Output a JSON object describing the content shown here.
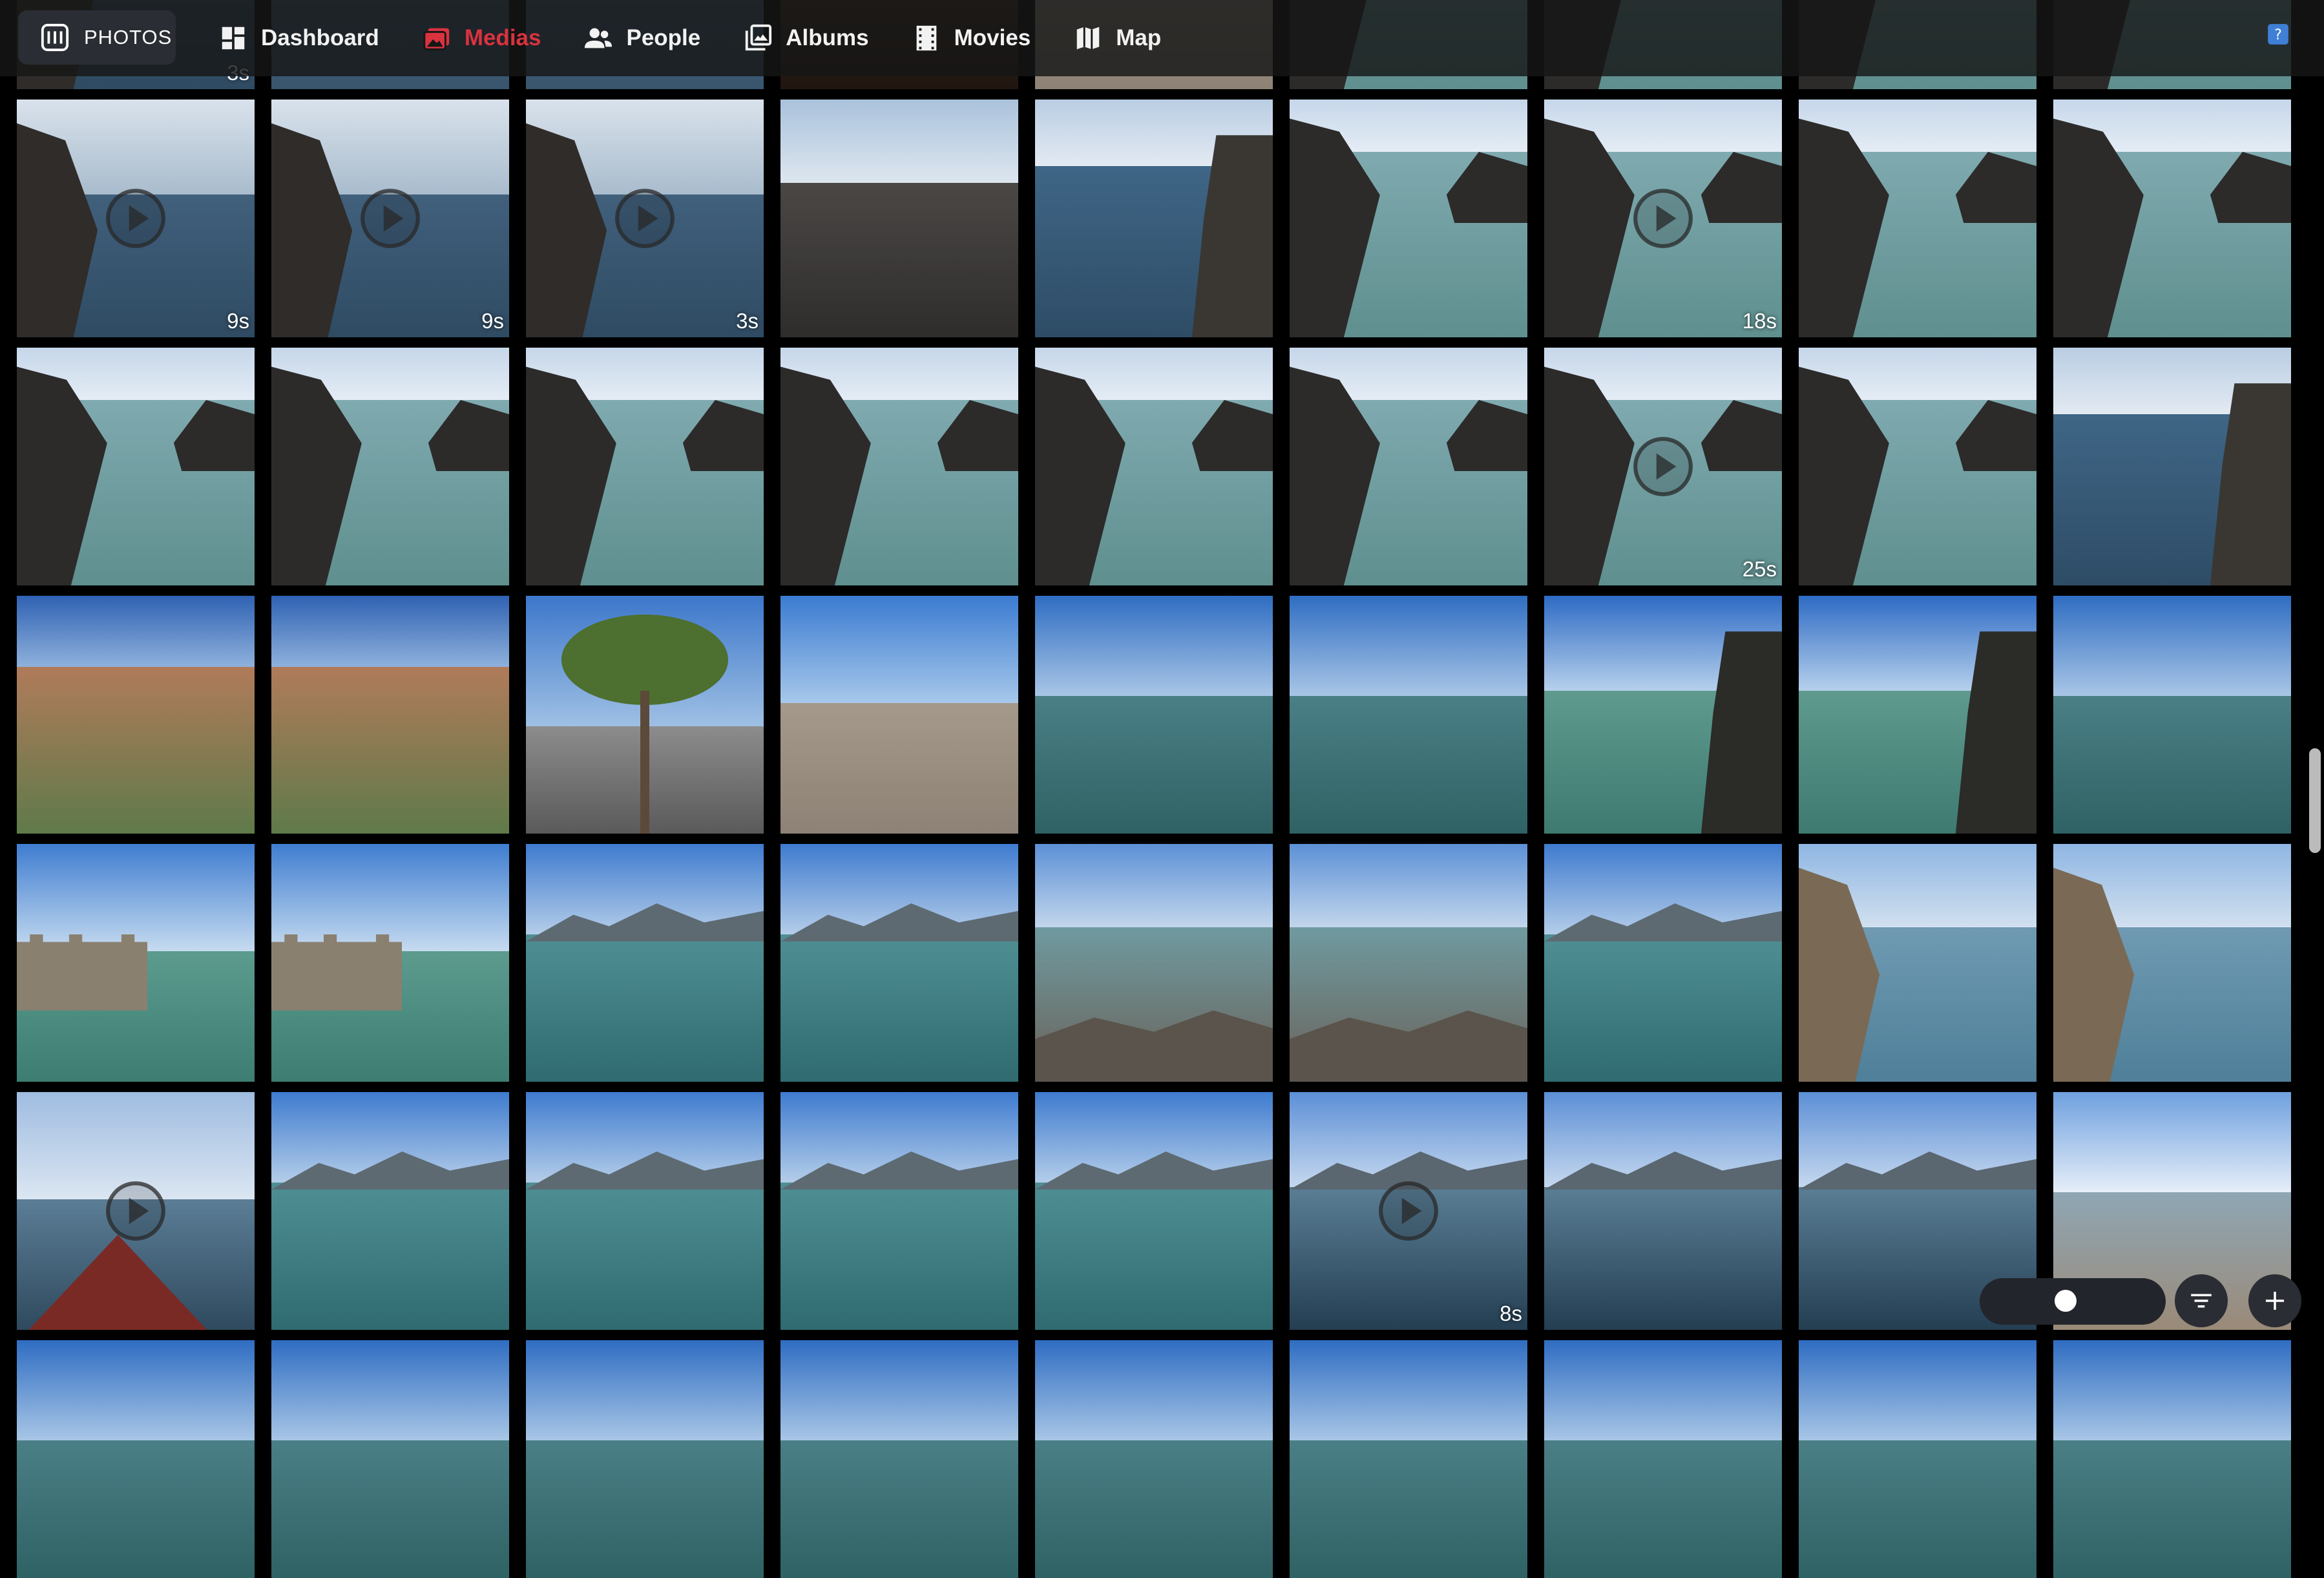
{
  "app": {
    "brand_label": "PHOTOS"
  },
  "nav": [
    {
      "label": "Dashboard",
      "icon": "dashboard-icon",
      "active": false
    },
    {
      "label": "Medias",
      "icon": "medias-icon",
      "active": true
    },
    {
      "label": "People",
      "icon": "people-icon",
      "active": false
    },
    {
      "label": "Albums",
      "icon": "albums-icon",
      "active": false
    },
    {
      "label": "Movies",
      "icon": "movies-icon",
      "active": false
    },
    {
      "label": "Map",
      "icon": "map-icon",
      "active": false
    }
  ],
  "accent_color": "#d8333f",
  "grid": {
    "rows": [
      {
        "tiles": [
          {
            "scene": "cliff",
            "video": false,
            "duration": "3s"
          },
          {
            "scene": "sea",
            "video": false,
            "duration": ""
          },
          {
            "scene": "sea",
            "video": false,
            "duration": ""
          },
          {
            "scene": "sunset",
            "video": false,
            "duration": ""
          },
          {
            "scene": "sand",
            "video": false,
            "duration": ""
          },
          {
            "scene": "pool",
            "video": false,
            "duration": ""
          },
          {
            "scene": "pool",
            "video": false,
            "duration": ""
          },
          {
            "scene": "pool",
            "video": false,
            "duration": ""
          },
          {
            "scene": "pool",
            "video": false,
            "duration": ""
          }
        ]
      },
      {
        "tiles": [
          {
            "scene": "cliff",
            "video": true,
            "duration": "9s"
          },
          {
            "scene": "cliff",
            "video": true,
            "duration": "9s"
          },
          {
            "scene": "cliff",
            "video": true,
            "duration": "3s"
          },
          {
            "scene": "blackbeach",
            "video": false,
            "duration": ""
          },
          {
            "scene": "coast",
            "video": false,
            "duration": ""
          },
          {
            "scene": "pool",
            "video": false,
            "duration": ""
          },
          {
            "scene": "pool",
            "video": true,
            "duration": "18s"
          },
          {
            "scene": "pool",
            "video": false,
            "duration": ""
          },
          {
            "scene": "pool",
            "video": false,
            "duration": ""
          }
        ]
      },
      {
        "tiles": [
          {
            "scene": "pool",
            "video": false,
            "duration": ""
          },
          {
            "scene": "pool",
            "video": false,
            "duration": ""
          },
          {
            "scene": "pool",
            "video": false,
            "duration": ""
          },
          {
            "scene": "pool",
            "video": false,
            "duration": ""
          },
          {
            "scene": "pool",
            "video": false,
            "duration": ""
          },
          {
            "scene": "pool",
            "video": false,
            "duration": ""
          },
          {
            "scene": "pool",
            "video": true,
            "duration": "25s"
          },
          {
            "scene": "pool",
            "video": false,
            "duration": ""
          },
          {
            "scene": "coast",
            "video": false,
            "duration": ""
          }
        ]
      },
      {
        "tiles": [
          {
            "scene": "town",
            "video": false,
            "duration": ""
          },
          {
            "scene": "town",
            "video": false,
            "duration": ""
          },
          {
            "scene": "tree",
            "video": false,
            "duration": ""
          },
          {
            "scene": "sand",
            "video": false,
            "duration": ""
          },
          {
            "scene": "lake",
            "video": false,
            "duration": ""
          },
          {
            "scene": "lake",
            "video": false,
            "duration": ""
          },
          {
            "scene": "tower",
            "video": false,
            "duration": ""
          },
          {
            "scene": "tower",
            "video": false,
            "duration": ""
          },
          {
            "scene": "lake",
            "video": false,
            "duration": ""
          }
        ]
      },
      {
        "tiles": [
          {
            "scene": "castle",
            "video": false,
            "duration": ""
          },
          {
            "scene": "castle",
            "video": false,
            "duration": ""
          },
          {
            "scene": "mountainlake",
            "video": false,
            "duration": ""
          },
          {
            "scene": "mountainlake",
            "video": false,
            "duration": ""
          },
          {
            "scene": "rockshore",
            "video": false,
            "duration": ""
          },
          {
            "scene": "rockshore",
            "video": false,
            "duration": ""
          },
          {
            "scene": "mountainlake",
            "video": false,
            "duration": ""
          },
          {
            "scene": "balcony",
            "video": false,
            "duration": ""
          },
          {
            "scene": "balcony",
            "video": false,
            "duration": ""
          }
        ]
      },
      {
        "tiles": [
          {
            "scene": "boat",
            "video": true,
            "duration": ""
          },
          {
            "scene": "mountainlake",
            "video": false,
            "duration": ""
          },
          {
            "scene": "mountainlake",
            "video": false,
            "duration": ""
          },
          {
            "scene": "mountainlake",
            "video": false,
            "duration": ""
          },
          {
            "scene": "mountainlake",
            "video": false,
            "duration": ""
          },
          {
            "scene": "sunlake",
            "video": true,
            "duration": "8s"
          },
          {
            "scene": "sunlake",
            "video": false,
            "duration": ""
          },
          {
            "scene": "sunlake",
            "video": false,
            "duration": ""
          },
          {
            "scene": "beach",
            "video": false,
            "duration": ""
          }
        ]
      },
      {
        "tiles": [
          {
            "scene": "lake",
            "video": false,
            "duration": ""
          },
          {
            "scene": "lake",
            "video": false,
            "duration": ""
          },
          {
            "scene": "lake",
            "video": false,
            "duration": ""
          },
          {
            "scene": "lake",
            "video": false,
            "duration": ""
          },
          {
            "scene": "lake",
            "video": false,
            "duration": ""
          },
          {
            "scene": "lake",
            "video": false,
            "duration": ""
          },
          {
            "scene": "lake",
            "video": false,
            "duration": ""
          },
          {
            "scene": "lake",
            "video": false,
            "duration": ""
          },
          {
            "scene": "lake",
            "video": false,
            "duration": ""
          }
        ]
      }
    ]
  },
  "controls": {
    "zoom_level": 0.45,
    "filter_icon": "filter-icon",
    "add_icon": "plus-icon",
    "help_icon": "help-icon"
  }
}
